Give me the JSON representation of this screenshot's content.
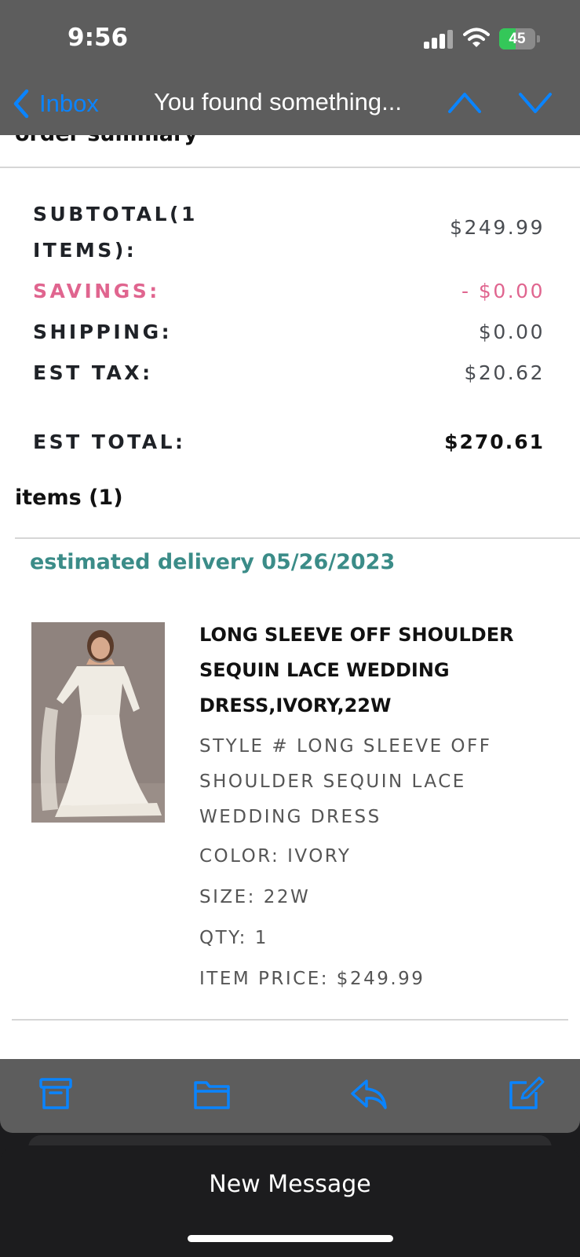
{
  "status_bar": {
    "time": "9:56",
    "battery_text": "45",
    "battery_level": 0.45,
    "icons": [
      "cellular-signal-icon",
      "wifi-icon",
      "battery-icon"
    ]
  },
  "nav": {
    "back_label": "Inbox",
    "title": "You found something...",
    "icons": [
      "chevron-left-icon",
      "chevron-up-icon",
      "chevron-down-icon"
    ]
  },
  "order_summary": {
    "heading": "order summary",
    "subtotal_label_line1": "SUBTOTAL(1",
    "subtotal_label_line2": "ITEMS):",
    "subtotal_value": "$249.99",
    "savings_label": "SAVINGS:",
    "savings_value": "- $0.00",
    "shipping_label": "SHIPPING:",
    "shipping_value": "$0.00",
    "tax_label": "EST TAX:",
    "tax_value": "$20.62",
    "total_label": "EST TOTAL:",
    "total_value": "$270.61"
  },
  "items": {
    "heading": "items (1)",
    "delivery": "estimated delivery 05/26/2023",
    "product": {
      "name": "LONG SLEEVE OFF SHOULDER SEQUIN LACE WEDDING DRESS,IVORY,22W",
      "style": "STYLE # LONG SLEEVE OFF SHOULDER SEQUIN LACE WEDDING DRESS",
      "color": "COLOR: IVORY",
      "size": "SIZE: 22W",
      "qty": "QTY: 1",
      "price": "ITEM PRICE: $249.99"
    }
  },
  "toolbar": {
    "icons": [
      "archive-icon",
      "folder-icon",
      "reply-icon",
      "compose-icon"
    ]
  },
  "new_message": {
    "label": "New Message"
  },
  "colors": {
    "accent_blue": "#0a84ff",
    "savings_pink": "#e0658f",
    "delivery_teal": "#3b8c88",
    "header_gray": "#5d5d5d"
  }
}
